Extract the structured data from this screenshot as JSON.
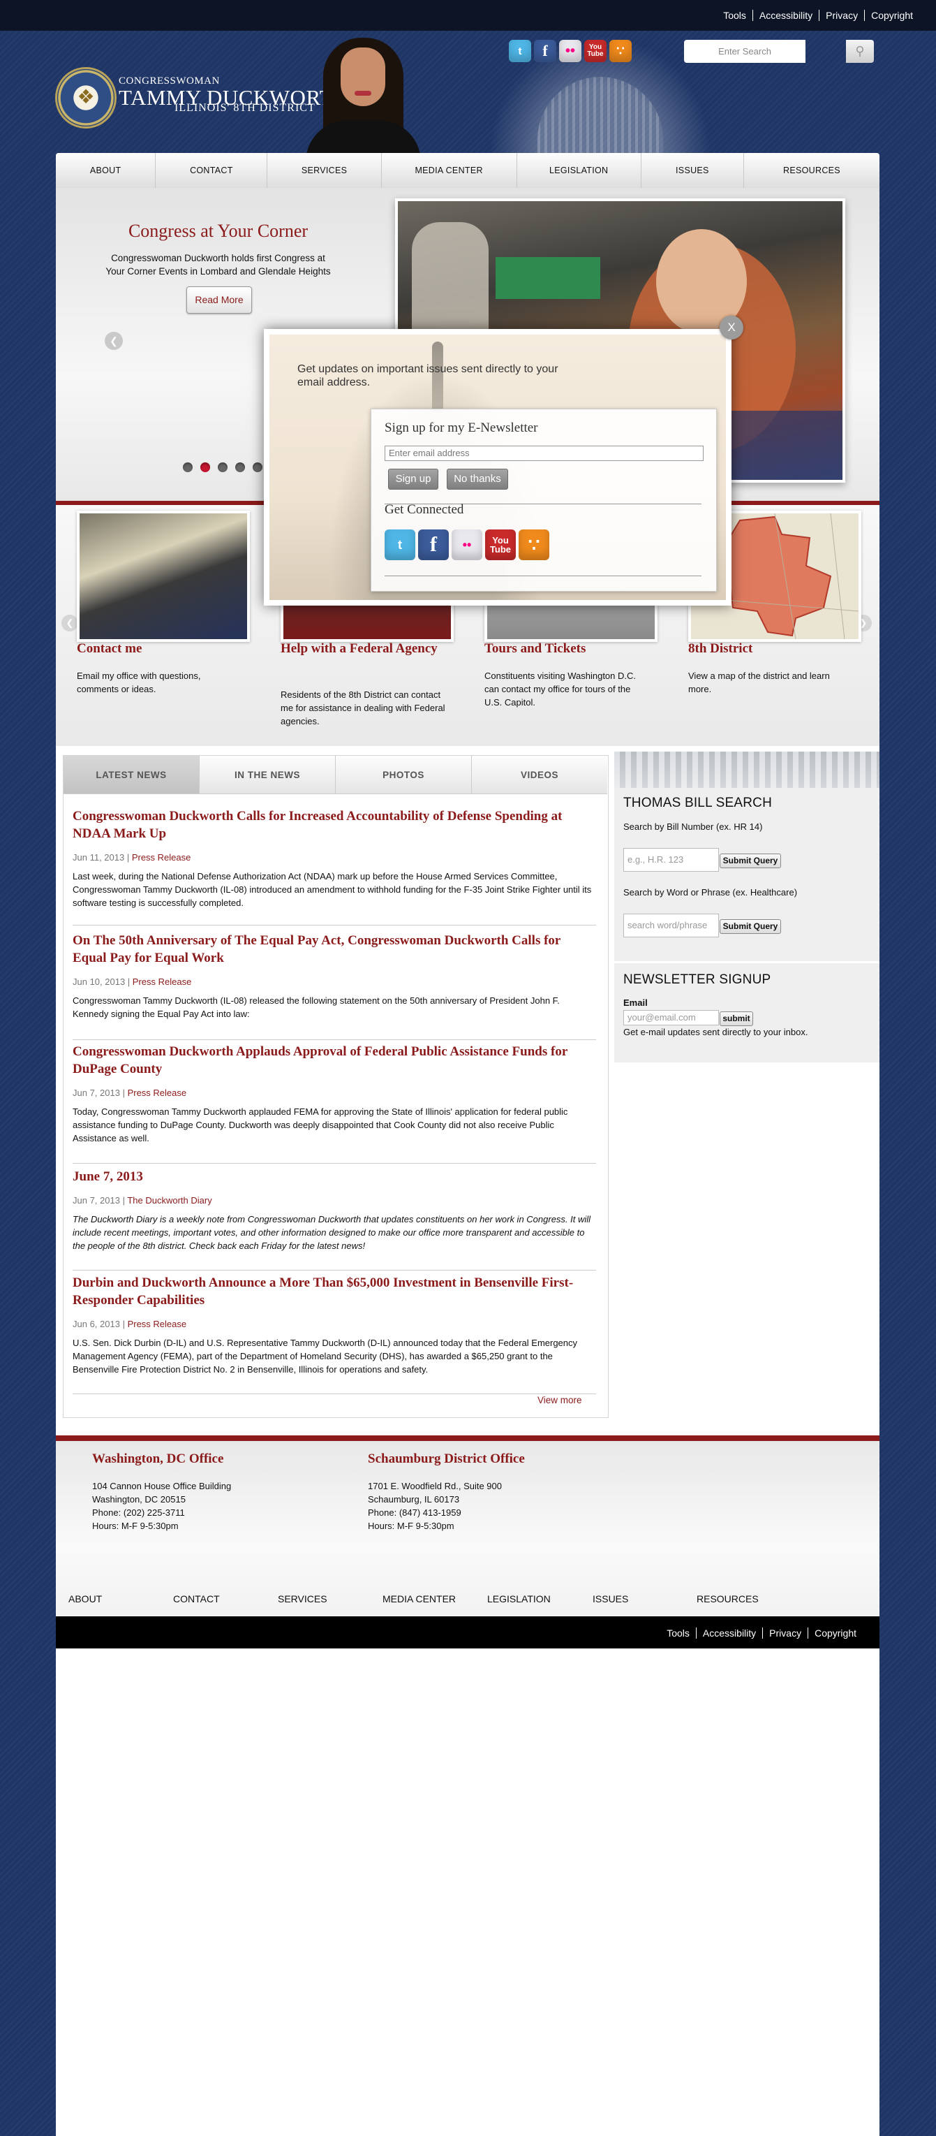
{
  "utility_links": [
    "Tools",
    "Accessibility",
    "Privacy",
    "Copyright"
  ],
  "header": {
    "logo_small": "CONGRESSWOMAN",
    "logo_name": "TAMMY DUCKWORTH",
    "logo_district": "ILLINOIS'   8TH DISTRICT",
    "search_placeholder": "Enter Search"
  },
  "social_icons": [
    "twitter-icon",
    "facebook-icon",
    "flickr-icon",
    "youtube-icon",
    "rss-icon"
  ],
  "nav": [
    "ABOUT",
    "CONTACT",
    "SERVICES",
    "MEDIA CENTER",
    "LEGISLATION",
    "ISSUES",
    "RESOURCES"
  ],
  "slider": {
    "title": "Congress at Your Corner",
    "text": "Congresswoman Duckworth holds first Congress at Your Corner Events in Lombard and Glendale Heights",
    "button": "Read More",
    "active_dot": 2,
    "dot_count": 5
  },
  "modal": {
    "intro": "Get updates on important issues sent directly to your email address.",
    "signup_title": "Sign up for my E-Newsletter",
    "email_placeholder": "Enter email address",
    "signup_button": "Sign up",
    "no_thanks_button": "No thanks",
    "connected_title": "Get Connected",
    "close_label": "X"
  },
  "features": [
    {
      "title": "Contact me",
      "text": "Email my office with questions, comments or ideas."
    },
    {
      "title": "Help with a Federal Agency",
      "text": "Residents of the 8th District can contact me for assistance in dealing with Federal agencies."
    },
    {
      "title": "Tours and Tickets",
      "text": "Constituents visiting Washington D.C. can contact my office for tours of the U.S. Capitol."
    },
    {
      "title": "8th District",
      "text": "View a map of the district and learn more."
    }
  ],
  "news_tabs": [
    "LATEST NEWS",
    "IN THE NEWS",
    "PHOTOS",
    "VIDEOS"
  ],
  "articles": [
    {
      "title": "Congresswoman Duckworth Calls for Increased Accountability of Defense Spending at NDAA Mark Up",
      "date": "Jun 11, 2013",
      "category": "Press Release",
      "body": "Last week, during the National Defense Authorization Act (NDAA) mark up before the House Armed Services Committee, Congresswoman Tammy Duckworth (IL-08) introduced an amendment to withhold funding for the F-35 Joint Strike Fighter until its software testing is successfully completed."
    },
    {
      "title": "On The 50th Anniversary of The Equal Pay Act, Congresswoman Duckworth Calls for Equal Pay for Equal Work",
      "date": "Jun 10, 2013",
      "category": "Press Release",
      "body": "Congresswoman Tammy Duckworth (IL-08) released the following statement on the 50th anniversary of President John F. Kennedy signing the Equal Pay Act into law:"
    },
    {
      "title": "Congresswoman Duckworth Applauds Approval of Federal Public Assistance Funds for DuPage County",
      "date": "Jun 7, 2013",
      "category": "Press Release",
      "body": "Today, Congresswoman Tammy Duckworth applauded FEMA for approving the State of Illinois' application for federal public assistance funding to DuPage County. Duckworth was deeply disappointed that Cook County did not also receive Public Assistance as well."
    },
    {
      "title": "June 7, 2013",
      "date": "Jun 7, 2013",
      "category": "The Duckworth Diary",
      "body": "The Duckworth Diary is a weekly note from Congresswoman Duckworth that updates constituents on her work in Congress. It will include recent meetings, important votes, and other information designed to make our office more transparent and accessible to the people of the 8th district. Check back each Friday for the latest news!"
    },
    {
      "title": "Durbin and Duckworth Announce a More Than $65,000 Investment in Bensenville First-Responder Capabilities",
      "date": "Jun 6, 2013",
      "category": "Press Release",
      "body": "U.S. Sen. Dick Durbin (D-IL) and U.S. Representative Tammy Duckworth (D-IL) announced today that the Federal Emergency Management Agency (FEMA), part of the Department of Homeland Security (DHS), has awarded a $65,250 grant to the Bensenville Fire Protection District No. 2 in Bensenville, Illinois for operations and safety."
    }
  ],
  "view_more": "View more",
  "thomas": {
    "title": "THOMAS BILL SEARCH",
    "bill_label": "Search by Bill Number (ex. HR 14)",
    "bill_placeholder": "e.g., H.R. 123",
    "submit": "Submit Query",
    "word_label": "Search by Word or Phrase (ex. Healthcare)",
    "word_placeholder": "search word/phrase"
  },
  "newsletter_side": {
    "title": "NEWSLETTER SIGNUP",
    "email_label": "Email",
    "email_placeholder": "your@email.com",
    "submit": "submit",
    "note": "Get e-mail updates sent directly to your inbox."
  },
  "offices": [
    {
      "title": "Washington, DC Office",
      "lines": [
        "104 Cannon House Office Building",
        "Washington, DC 20515",
        "Phone: (202) 225-3711",
        "Hours: M-F 9-5:30pm"
      ]
    },
    {
      "title": "Schaumburg District Office",
      "lines": [
        "1701 E. Woodfield Rd., Suite 900",
        "Schaumburg, IL 60173",
        "Phone: (847) 413-1959",
        "Hours: M-F 9-5:30pm"
      ]
    }
  ],
  "footer_nav": [
    "ABOUT",
    "CONTACT",
    "SERVICES",
    "MEDIA CENTER",
    "LEGISLATION",
    "ISSUES",
    "RESOURCES"
  ],
  "bottom_links": [
    "Tools",
    "Accessibility",
    "Privacy",
    "Copyright"
  ]
}
